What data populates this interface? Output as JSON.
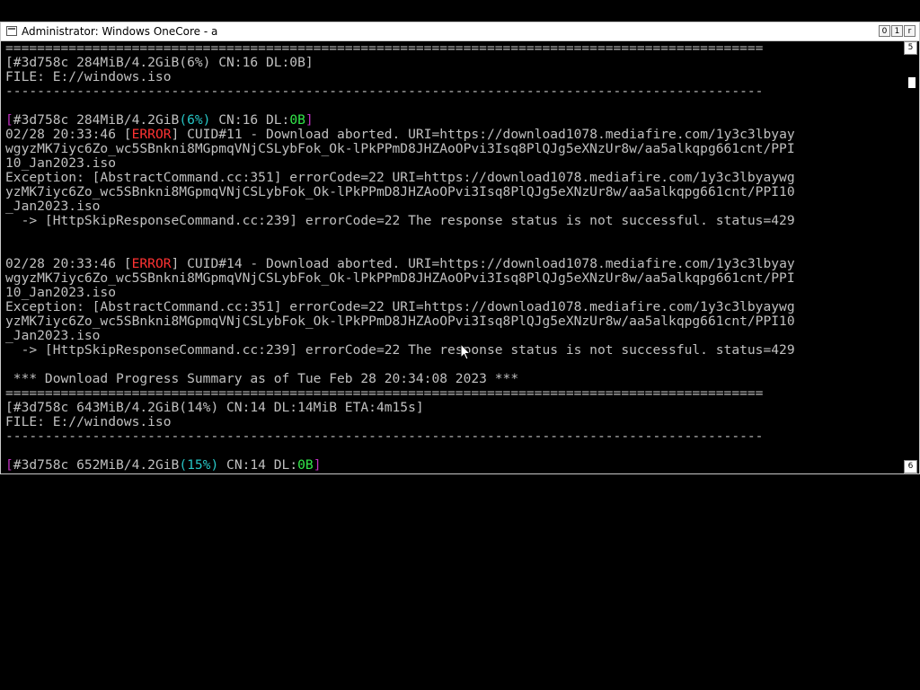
{
  "window": {
    "title": "Administrator:  Windows OneCore - a",
    "buttons": [
      "0",
      "1",
      "r"
    ],
    "scroll_up_label": "5",
    "scroll_down_label": "6"
  },
  "console": {
    "lines": [
      {
        "segments": [
          {
            "t": "================================================================================================"
          }
        ]
      },
      {
        "segments": [
          {
            "t": "[#3d758c 284MiB/4.2GiB(6%) CN:16 DL:0B]"
          }
        ]
      },
      {
        "segments": [
          {
            "t": "FILE: E://windows.iso"
          }
        ]
      },
      {
        "segments": [
          {
            "t": "------------------------------------------------------------------------------------------------"
          }
        ]
      },
      {
        "segments": [
          {
            "t": ""
          }
        ]
      },
      {
        "segments": [
          {
            "t": "[",
            "c": "mag"
          },
          {
            "t": "#3d758c 284MiB/4.2GiB"
          },
          {
            "t": "(6%)",
            "c": "cyan"
          },
          {
            "t": " CN:16 DL:"
          },
          {
            "t": "0B",
            "c": "grn"
          },
          {
            "t": "]",
            "c": "mag"
          }
        ]
      },
      {
        "segments": [
          {
            "t": "02/28 20:33:46 ["
          },
          {
            "t": "ERROR",
            "c": "err"
          },
          {
            "t": "] CUID#11 - Download aborted. URI=https://download1078.mediafire.com/1y3c3lbyay"
          }
        ]
      },
      {
        "segments": [
          {
            "t": "wgyzMK7iyc6Zo_wc5SBnkni8MGpmqVNjCSLybFok_Ok-lPkPPmD8JHZAoOPvi3Isq8PlQJg5eXNzUr8w/aa5alkqpg661cnt/PPI"
          }
        ]
      },
      {
        "segments": [
          {
            "t": "10_Jan2023.iso"
          }
        ]
      },
      {
        "segments": [
          {
            "t": "Exception: [AbstractCommand.cc:351] errorCode=22 URI=https://download1078.mediafire.com/1y3c3lbyaywg"
          }
        ]
      },
      {
        "segments": [
          {
            "t": "yzMK7iyc6Zo_wc5SBnkni8MGpmqVNjCSLybFok_Ok-lPkPPmD8JHZAoOPvi3Isq8PlQJg5eXNzUr8w/aa5alkqpg661cnt/PPI10"
          }
        ]
      },
      {
        "segments": [
          {
            "t": "_Jan2023.iso"
          }
        ]
      },
      {
        "segments": [
          {
            "t": "  -> [HttpSkipResponseCommand.cc:239] errorCode=22 The response status is not successful. status=429"
          }
        ]
      },
      {
        "segments": [
          {
            "t": ""
          }
        ]
      },
      {
        "segments": [
          {
            "t": ""
          }
        ]
      },
      {
        "segments": [
          {
            "t": "02/28 20:33:46 ["
          },
          {
            "t": "ERROR",
            "c": "err"
          },
          {
            "t": "] CUID#14 - Download aborted. URI=https://download1078.mediafire.com/1y3c3lbyay"
          }
        ]
      },
      {
        "segments": [
          {
            "t": "wgyzMK7iyc6Zo_wc5SBnkni8MGpmqVNjCSLybFok_Ok-lPkPPmD8JHZAoOPvi3Isq8PlQJg5eXNzUr8w/aa5alkqpg661cnt/PPI"
          }
        ]
      },
      {
        "segments": [
          {
            "t": "10_Jan2023.iso"
          }
        ]
      },
      {
        "segments": [
          {
            "t": "Exception: [AbstractCommand.cc:351] errorCode=22 URI=https://download1078.mediafire.com/1y3c3lbyaywg"
          }
        ]
      },
      {
        "segments": [
          {
            "t": "yzMK7iyc6Zo_wc5SBnkni8MGpmqVNjCSLybFok_Ok-lPkPPmD8JHZAoOPvi3Isq8PlQJg5eXNzUr8w/aa5alkqpg661cnt/PPI10"
          }
        ]
      },
      {
        "segments": [
          {
            "t": "_Jan2023.iso"
          }
        ]
      },
      {
        "segments": [
          {
            "t": "  -> [HttpSkipResponseCommand.cc:239] errorCode=22 The response status is not successful. status=429"
          }
        ]
      },
      {
        "segments": [
          {
            "t": ""
          }
        ]
      },
      {
        "segments": [
          {
            "t": " *** Download Progress Summary as of Tue Feb 28 20:34:08 2023 ***"
          }
        ]
      },
      {
        "segments": [
          {
            "t": "================================================================================================"
          }
        ]
      },
      {
        "segments": [
          {
            "t": "[#3d758c 643MiB/4.2GiB(14%) CN:14 DL:14MiB ETA:4m15s]"
          }
        ]
      },
      {
        "segments": [
          {
            "t": "FILE: E://windows.iso"
          }
        ]
      },
      {
        "segments": [
          {
            "t": "------------------------------------------------------------------------------------------------"
          }
        ]
      },
      {
        "segments": [
          {
            "t": ""
          }
        ]
      },
      {
        "segments": [
          {
            "t": "[",
            "c": "mag"
          },
          {
            "t": "#3d758c 652MiB/4.2GiB"
          },
          {
            "t": "(15%)",
            "c": "cyan"
          },
          {
            "t": " CN:14 DL:"
          },
          {
            "t": "0B",
            "c": "grn"
          },
          {
            "t": "]",
            "c": "mag"
          }
        ]
      }
    ]
  }
}
